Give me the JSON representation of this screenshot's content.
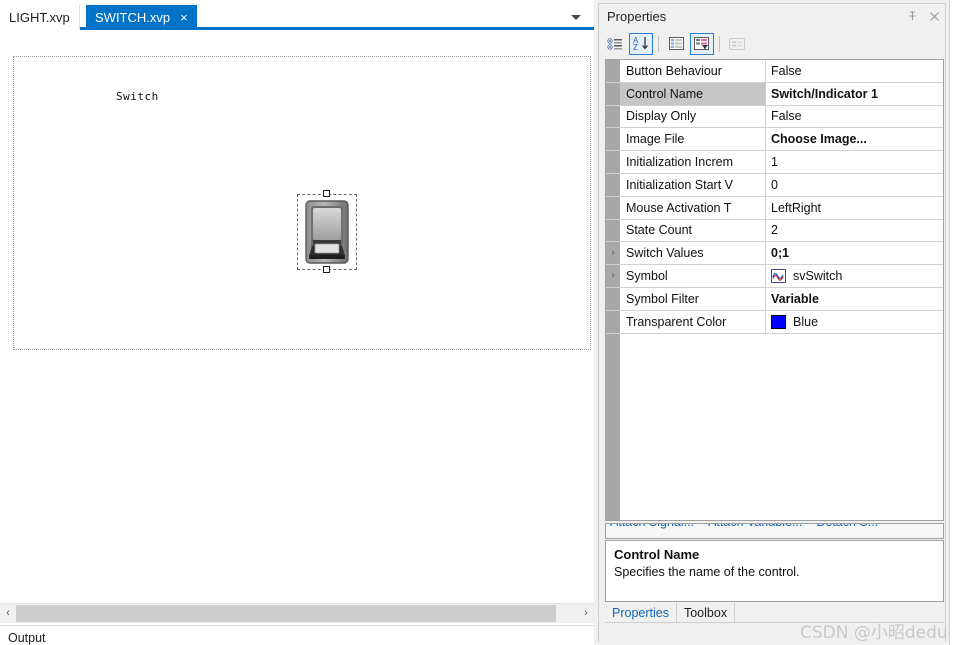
{
  "menu_strip": {
    "partial_text": "· · · · ·"
  },
  "editor": {
    "tabs": [
      {
        "label": "LIGHT.xvp",
        "active": false
      },
      {
        "label": "SWITCH.xvp",
        "active": true,
        "close_glyph": "×"
      }
    ],
    "tab_dropdown_icon": "chevron-down-icon",
    "canvas": {
      "control_label": "Switch",
      "control_icon": "rocker-switch-graphic"
    },
    "scrollbar": {
      "left_arrow": "‹",
      "right_arrow": "›"
    },
    "output_label": "Output"
  },
  "properties": {
    "title": "Properties",
    "pin_icon": "pin-icon",
    "close_icon": "close-icon",
    "toolbar": [
      {
        "name": "categorized-button",
        "selected": false
      },
      {
        "name": "alphabetical-sort-button",
        "selected": true
      },
      {
        "name": "property-pages-button",
        "selected": false
      },
      {
        "name": "property-filter-button",
        "selected": true
      },
      {
        "name": "property-events-button",
        "selected": false,
        "disabled": true
      }
    ],
    "rows": [
      {
        "expandable": false,
        "name": "Button Behaviour",
        "value": "False",
        "bold": false,
        "selected": false
      },
      {
        "expandable": false,
        "name": "Control Name",
        "value": "Switch/Indicator 1",
        "bold": true,
        "selected": true
      },
      {
        "expandable": false,
        "name": "Display Only",
        "value": "False",
        "bold": false,
        "selected": false
      },
      {
        "expandable": false,
        "name": "Image File",
        "value": "Choose Image...",
        "bold": true,
        "selected": false
      },
      {
        "expandable": false,
        "name": "Initialization Increm",
        "value": "1",
        "bold": false,
        "selected": false
      },
      {
        "expandable": false,
        "name": "Initialization Start V",
        "value": "0",
        "bold": false,
        "selected": false
      },
      {
        "expandable": false,
        "name": "Mouse Activation T",
        "value": "LeftRight",
        "bold": false,
        "selected": false
      },
      {
        "expandable": false,
        "name": "State Count",
        "value": "2",
        "bold": false,
        "selected": false
      },
      {
        "expandable": true,
        "name": "Switch Values",
        "value": "0;1",
        "bold": true,
        "selected": false
      },
      {
        "expandable": true,
        "name": "Symbol",
        "value": "svSwitch",
        "bold": false,
        "selected": false,
        "icon": "waveform-icon"
      },
      {
        "expandable": false,
        "name": "Symbol Filter",
        "value": "Variable",
        "bold": true,
        "selected": false
      },
      {
        "expandable": false,
        "name": "Transparent Color",
        "value": "Blue",
        "bold": false,
        "selected": false,
        "swatch": "#0000ff"
      }
    ],
    "links": [
      "Attach Signal...",
      "Attach Variable...",
      "Detach S..."
    ],
    "description": {
      "title": "Control Name",
      "text": "Specifies the name of the control."
    },
    "bottom_tabs": [
      {
        "label": "Properties",
        "active": true
      },
      {
        "label": "Toolbox",
        "active": false
      }
    ]
  },
  "watermark": "CSDN @小昭dedug",
  "colors": {
    "accent_blue": "#0073c8",
    "link_blue": "#1464b4",
    "selected_row": "#c6c6c6",
    "gutter": "#a8a8a8",
    "transparent_color": "#0000ff"
  }
}
